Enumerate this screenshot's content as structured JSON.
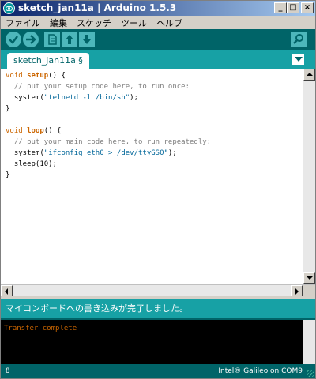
{
  "window": {
    "title": "sketch_jan11a | Arduino 1.5.3",
    "controls": {
      "minimize": "_",
      "maximize": "□",
      "close": "×"
    }
  },
  "menu": [
    "ファイル",
    "編集",
    "スケッチ",
    "ツール",
    "ヘルプ"
  ],
  "toolbar": {
    "buttons": [
      "verify-icon",
      "upload-icon",
      "new-icon",
      "open-icon",
      "save-icon",
      "serial-monitor-icon"
    ]
  },
  "tabs": [
    {
      "label": "sketch_jan11a §"
    }
  ],
  "editor": {
    "lines": [
      [
        {
          "t": "void",
          "c": "kw1"
        },
        {
          "t": " "
        },
        {
          "t": "setup",
          "c": "kw2"
        },
        {
          "t": "() {"
        }
      ],
      [
        {
          "t": "  // put your setup code here, to run once:",
          "c": "cm"
        }
      ],
      [
        {
          "t": "  system("
        },
        {
          "t": "\"telnetd -l /bin/sh\"",
          "c": "st"
        },
        {
          "t": ");"
        }
      ],
      [
        {
          "t": "}"
        }
      ],
      [
        {
          "t": ""
        }
      ],
      [
        {
          "t": "void",
          "c": "kw1"
        },
        {
          "t": " "
        },
        {
          "t": "loop",
          "c": "kw2"
        },
        {
          "t": "() {"
        }
      ],
      [
        {
          "t": "  // put your main code here, to run repeatedly:",
          "c": "cm"
        }
      ],
      [
        {
          "t": "  system("
        },
        {
          "t": "\"ifconfig eth0 > /dev/ttyGS0\"",
          "c": "st"
        },
        {
          "t": ");"
        }
      ],
      [
        {
          "t": "  sleep(10);"
        }
      ],
      [
        {
          "t": "}"
        }
      ]
    ]
  },
  "status": {
    "message": "マイコンボードへの書き込みが完了しました。"
  },
  "console": {
    "text": "Transfer complete"
  },
  "footer": {
    "line": "8",
    "board": "Intel® Galileo on COM9"
  },
  "colors": {
    "accent": "#006468",
    "teal": "#17a1a5",
    "keyword": "#cc6600"
  }
}
